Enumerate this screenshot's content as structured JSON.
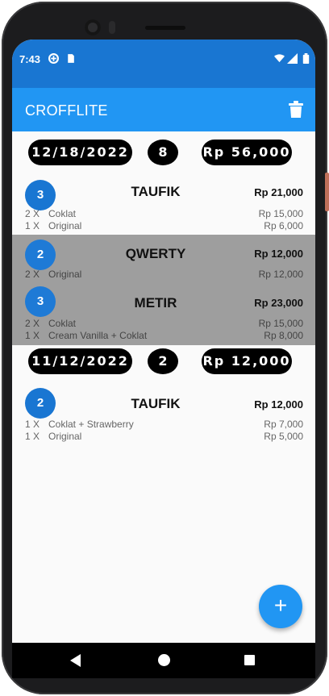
{
  "status": {
    "time": "7:43"
  },
  "app": {
    "title": "CROFFLITE",
    "delete_icon": "trash-icon",
    "primary_color": "#2196f3",
    "dark_color": "#1976d2"
  },
  "days": [
    {
      "date": "12/18/2022",
      "count": "8",
      "total": "Rp 56,000",
      "orders": [
        {
          "badge": "3",
          "customer": "TAUFIK",
          "total": "Rp 21,000",
          "selected": false,
          "items": [
            {
              "qty": "2 X",
              "name": "Coklat",
              "price": "Rp 15,000"
            },
            {
              "qty": "1 X",
              "name": "Original",
              "price": "Rp 6,000"
            }
          ]
        },
        {
          "badge": "2",
          "customer": "QWERTY",
          "total": "Rp 12,000",
          "selected": true,
          "items": [
            {
              "qty": "2 X",
              "name": "Original",
              "price": "Rp 12,000"
            }
          ]
        },
        {
          "badge": "3",
          "customer": "METIR",
          "total": "Rp 23,000",
          "selected": true,
          "items": [
            {
              "qty": "2 X",
              "name": "Coklat",
              "price": "Rp 15,000"
            },
            {
              "qty": "1 X",
              "name": "Cream Vanilla + Coklat",
              "price": "Rp 8,000"
            }
          ]
        }
      ]
    },
    {
      "date": "11/12/2022",
      "count": "2",
      "total": "Rp 12,000",
      "orders": [
        {
          "badge": "2",
          "customer": "TAUFIK",
          "total": "Rp 12,000",
          "selected": false,
          "items": [
            {
              "qty": "1 X",
              "name": "Coklat + Strawberry",
              "price": "Rp 7,000"
            },
            {
              "qty": "1 X",
              "name": "Original",
              "price": "Rp 5,000"
            }
          ]
        }
      ]
    }
  ],
  "fab": {
    "label": "+",
    "icon": "plus-icon"
  },
  "nav": {
    "back_icon": "back-icon",
    "home_icon": "home-icon",
    "recents_icon": "recents-icon"
  }
}
